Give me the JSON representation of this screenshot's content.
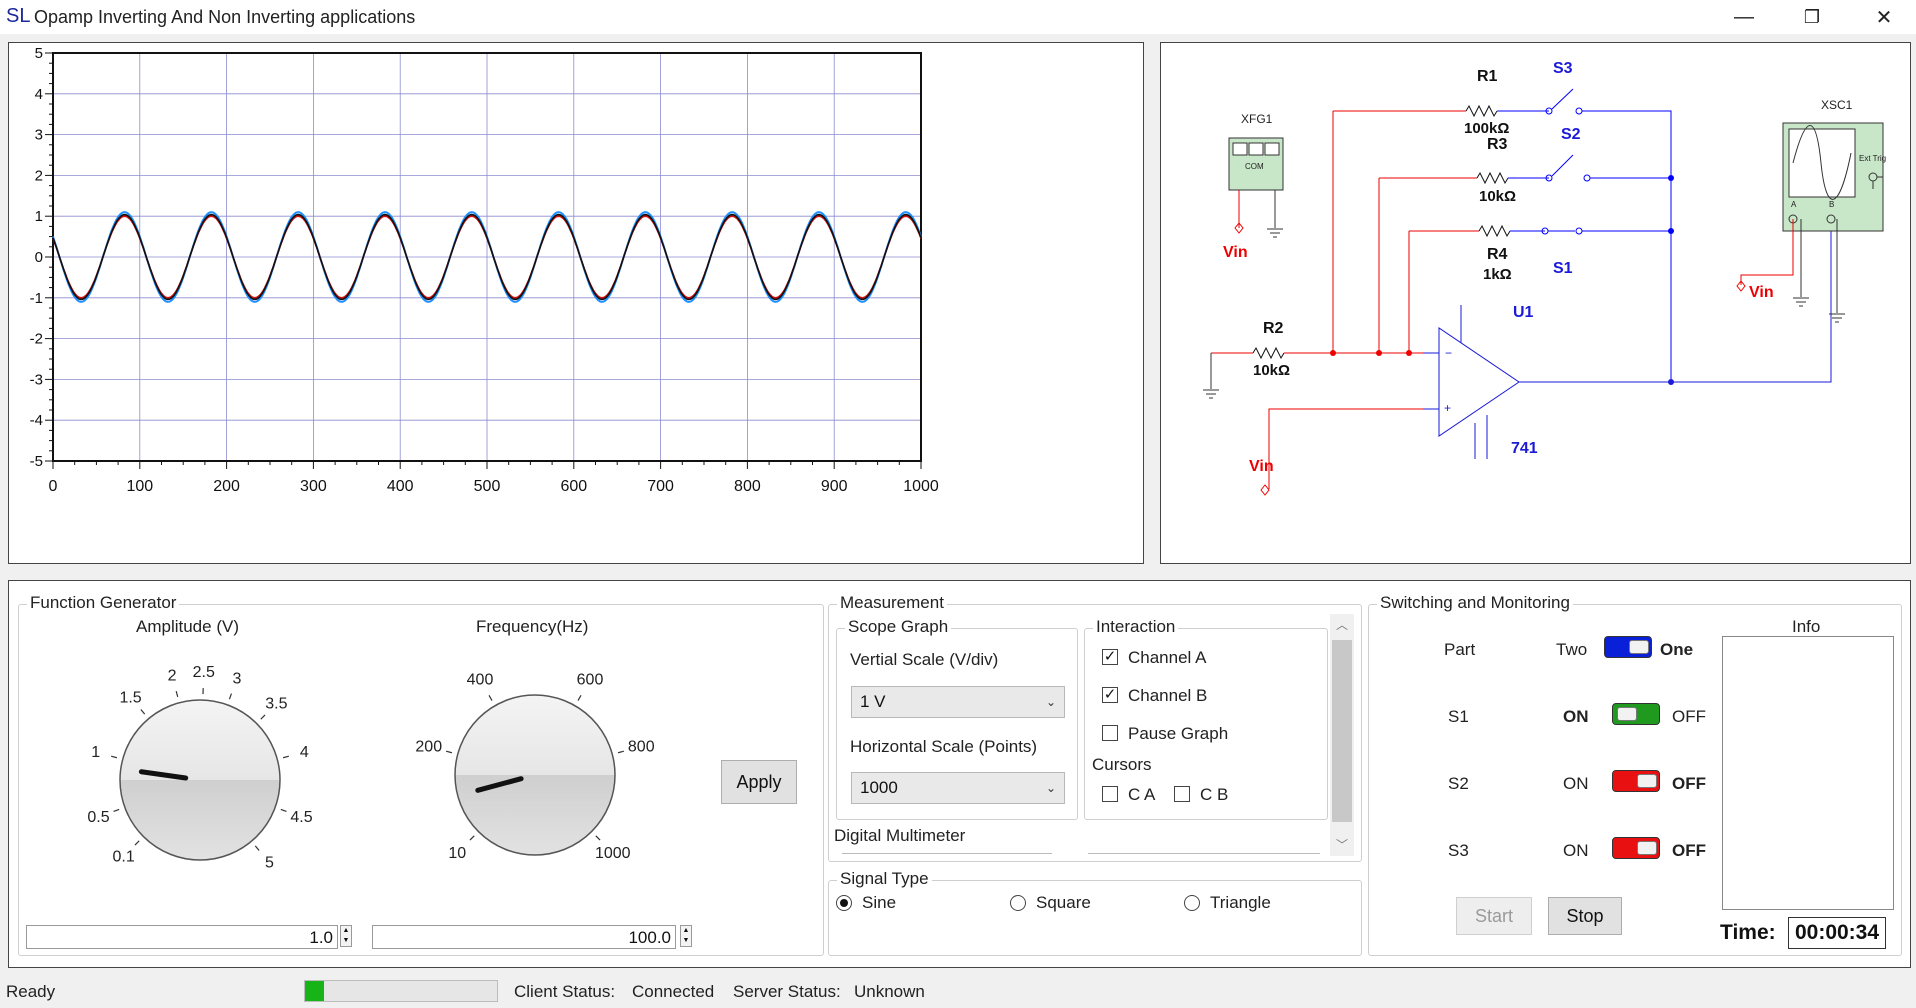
{
  "window": {
    "logo": "SL",
    "title": "Opamp Inverting And Non Inverting applications",
    "minimize_glyph": "—",
    "maximize_glyph": "❐",
    "close_glyph": "✕"
  },
  "scope_graph": {
    "y_ticks": [
      "5",
      "4",
      "3",
      "2",
      "1",
      "0",
      "-1",
      "-2",
      "-3",
      "-4",
      "-5"
    ],
    "x_ticks": [
      "0",
      "100",
      "200",
      "300",
      "400",
      "500",
      "600",
      "700",
      "800",
      "900",
      "1000"
    ]
  },
  "chart_data": {
    "type": "line",
    "xlim": [
      0,
      1000
    ],
    "ylim": [
      -5,
      5
    ],
    "grid": true,
    "series": [
      {
        "color": "#1e90ff",
        "amplitude": 1.1,
        "period": 100,
        "phase_note": "sine"
      },
      {
        "color": "#d01010",
        "amplitude": 1.0,
        "period": 100,
        "phase_note": "sine"
      },
      {
        "color": "#111111",
        "amplitude": 1.04,
        "period": 100,
        "phase_note": "sine"
      }
    ]
  },
  "circuit": {
    "xfg1": "XFG1",
    "xfg_com": "COM",
    "xsc1": "XSC1",
    "xsc_ext": "Ext Trig",
    "xsc_a": "A",
    "xsc_b": "B",
    "r1": "R1",
    "r1_val": "100kΩ",
    "r3": "R3",
    "r3_val": "10kΩ",
    "r4": "R4",
    "r4_val": "1kΩ",
    "r2": "R2",
    "r2_val": "10kΩ",
    "s1": "S1",
    "s2": "S2",
    "s3": "S3",
    "u1": "U1",
    "opamp": "741",
    "vin": "Vin"
  },
  "function_generator": {
    "title": "Function Generator",
    "amplitude_label": "Amplitude (V)",
    "amplitude_ticks": [
      "0.1",
      "0.5",
      "1",
      "1.5",
      "2",
      "2.5",
      "3",
      "3.5",
      "4",
      "4.5",
      "5"
    ],
    "amplitude_value": "1.0",
    "frequency_label": "Frequency(Hz)",
    "frequency_ticks": [
      "10",
      "200",
      "400",
      "600",
      "800",
      "1000"
    ],
    "frequency_value": "100.0",
    "apply": "Apply"
  },
  "measurement": {
    "title": "Measurement",
    "scope_graph": "Scope Graph",
    "vertical_scale_label": "Vertial Scale (V/div)",
    "vertical_scale_value": "1 V",
    "horizontal_scale_label": "Horizontal Scale (Points)",
    "horizontal_scale_value": "1000",
    "interaction": "Interaction",
    "channel_a": "Channel A",
    "channel_b": "Channel B",
    "pause_graph": "Pause Graph",
    "cursors": "Cursors",
    "ca": "C A",
    "cb": "C B",
    "digital_multimeter": "Digital Multimeter"
  },
  "signal_type": {
    "title": "Signal Type",
    "sine": "Sine",
    "square": "Square",
    "triangle": "Triangle",
    "selected": "Sine"
  },
  "switching": {
    "title": "Switching and Monitoring",
    "part_label": "Part",
    "part_left": "Two",
    "part_right": "One",
    "s1": "S1",
    "s2": "S2",
    "s3": "S3",
    "on": "ON",
    "off": "OFF",
    "info": "Info",
    "start": "Start",
    "stop": "Stop",
    "time_label": "Time:",
    "time_value": "00:00:34"
  },
  "status": {
    "ready": "Ready",
    "progress": 0.1,
    "client_label": "Client Status:",
    "client_value": "Connected",
    "server_label": "Server Status:",
    "server_value": "Unknown"
  },
  "colors": {
    "toggle_blue": "#0a1fd8",
    "toggle_green": "#1f9a1f",
    "toggle_red": "#e81010",
    "progress_green": "#16b416"
  }
}
